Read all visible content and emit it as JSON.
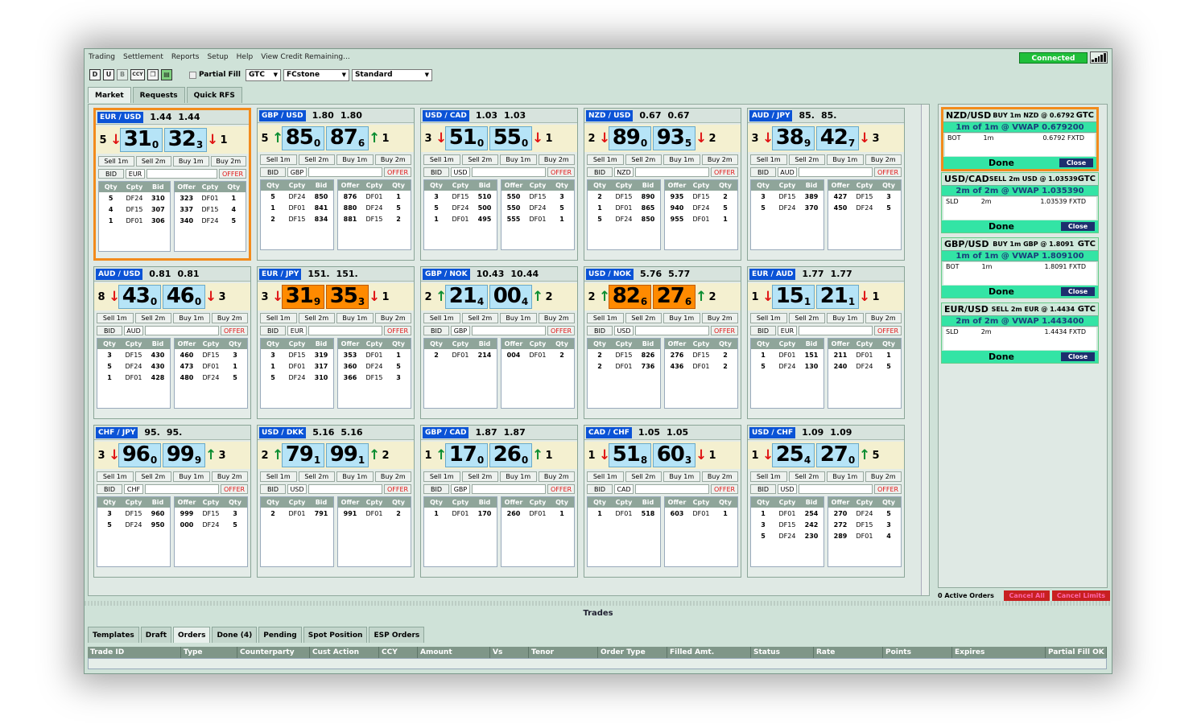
{
  "menu": [
    "Trading",
    "Settlement",
    "Reports",
    "Setup",
    "Help",
    "View Credit Remaining..."
  ],
  "status": "Connected",
  "toolbar": {
    "icons": [
      "D",
      "U",
      "B",
      "CCY",
      "copy-icon",
      "sheet-icon"
    ],
    "partial_fill": "Partial Fill",
    "tif": "GTC",
    "counterparty": "FCstone",
    "profile": "Standard"
  },
  "tabs": [
    "Market",
    "Requests",
    "Quick RFS"
  ],
  "tile_labels": {
    "sell1": "Sell 1m",
    "sell2": "Sell 2m",
    "buy1": "Buy 1m",
    "buy2": "Buy 2m",
    "bid": "BID",
    "offer": "OFFER",
    "cols": [
      "Qty",
      "Cpty",
      "Bid",
      "Offer",
      "Cpty",
      "Qty"
    ]
  },
  "tiles": [
    {
      "pair": "EUR / USD",
      "h1": "1.44",
      "h2": "1.44",
      "lq": "5",
      "la": "dn",
      "bid": "31",
      "bs": "0",
      "ask": "32",
      "as": "3",
      "ra": "dn",
      "rq": "1",
      "ccy": "EUR",
      "sel": true,
      "bids": [
        [
          "5",
          "DF24",
          "310"
        ],
        [
          "4",
          "DF15",
          "307"
        ],
        [
          "1",
          "DF01",
          "306"
        ]
      ],
      "offers": [
        [
          "323",
          "DF01",
          "1"
        ],
        [
          "337",
          "DF15",
          "4"
        ],
        [
          "340",
          "DF24",
          "5"
        ]
      ]
    },
    {
      "pair": "GBP / USD",
      "h1": "1.80",
      "h2": "1.80",
      "lq": "5",
      "la": "up",
      "bid": "85",
      "bs": "0",
      "ask": "87",
      "as": "6",
      "ra": "up",
      "rq": "1",
      "ccy": "GBP",
      "bids": [
        [
          "5",
          "DF24",
          "850"
        ],
        [
          "1",
          "DF01",
          "841"
        ],
        [
          "2",
          "DF15",
          "834"
        ]
      ],
      "offers": [
        [
          "876",
          "DF01",
          "1"
        ],
        [
          "880",
          "DF24",
          "5"
        ],
        [
          "881",
          "DF15",
          "2"
        ]
      ]
    },
    {
      "pair": "USD / CAD",
      "h1": "1.03",
      "h2": "1.03",
      "lq": "3",
      "la": "dn",
      "bid": "51",
      "bs": "0",
      "ask": "55",
      "as": "0",
      "ra": "dn",
      "rq": "1",
      "ccy": "USD",
      "bids": [
        [
          "3",
          "DF15",
          "510"
        ],
        [
          "5",
          "DF24",
          "500"
        ],
        [
          "1",
          "DF01",
          "495"
        ]
      ],
      "offers": [
        [
          "550",
          "DF15",
          "3"
        ],
        [
          "550",
          "DF24",
          "5"
        ],
        [
          "555",
          "DF01",
          "1"
        ]
      ]
    },
    {
      "pair": "NZD / USD",
      "h1": "0.67",
      "h2": "0.67",
      "lq": "2",
      "la": "dn",
      "bid": "89",
      "bs": "0",
      "ask": "93",
      "as": "5",
      "ra": "dn",
      "rq": "2",
      "ccy": "NZD",
      "bids": [
        [
          "2",
          "DF15",
          "890"
        ],
        [
          "1",
          "DF01",
          "865"
        ],
        [
          "5",
          "DF24",
          "850"
        ]
      ],
      "offers": [
        [
          "935",
          "DF15",
          "2"
        ],
        [
          "940",
          "DF24",
          "5"
        ],
        [
          "955",
          "DF01",
          "1"
        ]
      ]
    },
    {
      "pair": "AUD / JPY",
      "h1": "85.",
      "h2": "85.",
      "lq": "3",
      "la": "dn",
      "bid": "38",
      "bs": "9",
      "ask": "42",
      "as": "7",
      "ra": "dn",
      "rq": "3",
      "ccy": "AUD",
      "bids": [
        [
          "3",
          "DF15",
          "389"
        ],
        [
          "5",
          "DF24",
          "370"
        ]
      ],
      "offers": [
        [
          "427",
          "DF15",
          "3"
        ],
        [
          "450",
          "DF24",
          "5"
        ]
      ]
    },
    {
      "pair": "AUD / USD",
      "h1": "0.81",
      "h2": "0.81",
      "lq": "8",
      "la": "dn",
      "bid": "43",
      "bs": "0",
      "ask": "46",
      "as": "0",
      "ra": "dn",
      "rq": "3",
      "ccy": "AUD",
      "bids": [
        [
          "3",
          "DF15",
          "430"
        ],
        [
          "5",
          "DF24",
          "430"
        ],
        [
          "1",
          "DF01",
          "428"
        ]
      ],
      "offers": [
        [
          "460",
          "DF15",
          "3"
        ],
        [
          "473",
          "DF01",
          "1"
        ],
        [
          "480",
          "DF24",
          "5"
        ]
      ]
    },
    {
      "pair": "EUR / JPY",
      "h1": "151.",
      "h2": "151.",
      "lq": "3",
      "la": "dn",
      "bid": "31",
      "bs": "9",
      "ask": "35",
      "as": "3",
      "ra": "dn",
      "rq": "1",
      "ccy": "EUR",
      "hot": true,
      "bids": [
        [
          "3",
          "DF15",
          "319"
        ],
        [
          "1",
          "DF01",
          "317"
        ],
        [
          "5",
          "DF24",
          "310"
        ]
      ],
      "offers": [
        [
          "353",
          "DF01",
          "1"
        ],
        [
          "360",
          "DF24",
          "5"
        ],
        [
          "366",
          "DF15",
          "3"
        ]
      ]
    },
    {
      "pair": "GBP / NOK",
      "h1": "10.43",
      "h2": "10.44",
      "lq": "2",
      "la": "up",
      "bid": "21",
      "bs": "4",
      "ask": "00",
      "as": "4",
      "ra": "up",
      "rq": "2",
      "ccy": "GBP",
      "bids": [
        [
          "2",
          "DF01",
          "214"
        ]
      ],
      "offers": [
        [
          "004",
          "DF01",
          "2"
        ]
      ]
    },
    {
      "pair": "USD / NOK",
      "h1": "5.76",
      "h2": "5.77",
      "lq": "2",
      "la": "up",
      "bid": "82",
      "bs": "6",
      "ask": "27",
      "as": "6",
      "ra": "up",
      "rq": "2",
      "ccy": "USD",
      "hot": true,
      "bids": [
        [
          "2",
          "DF15",
          "826"
        ],
        [
          "2",
          "DF01",
          "736"
        ]
      ],
      "offers": [
        [
          "276",
          "DF15",
          "2"
        ],
        [
          "436",
          "DF01",
          "2"
        ]
      ]
    },
    {
      "pair": "EUR / AUD",
      "h1": "1.77",
      "h2": "1.77",
      "lq": "1",
      "la": "dn",
      "bid": "15",
      "bs": "1",
      "ask": "21",
      "as": "1",
      "ra": "dn",
      "rq": "1",
      "ccy": "EUR",
      "bids": [
        [
          "1",
          "DF01",
          "151"
        ],
        [
          "5",
          "DF24",
          "130"
        ]
      ],
      "offers": [
        [
          "211",
          "DF01",
          "1"
        ],
        [
          "240",
          "DF24",
          "5"
        ]
      ]
    },
    {
      "pair": "CHF / JPY",
      "h1": "95.",
      "h2": "95.",
      "lq": "3",
      "la": "dn",
      "bid": "96",
      "bs": "0",
      "ask": "99",
      "as": "9",
      "ra": "up",
      "rq": "3",
      "ccy": "CHF",
      "bids": [
        [
          "3",
          "DF15",
          "960"
        ],
        [
          "5",
          "DF24",
          "950"
        ]
      ],
      "offers": [
        [
          "999",
          "DF15",
          "3"
        ],
        [
          "000",
          "DF24",
          "5"
        ]
      ]
    },
    {
      "pair": "USD / DKK",
      "h1": "5.16",
      "h2": "5.16",
      "lq": "2",
      "la": "up",
      "bid": "79",
      "bs": "1",
      "ask": "99",
      "as": "1",
      "ra": "up",
      "rq": "2",
      "ccy": "USD",
      "bids": [
        [
          "2",
          "DF01",
          "791"
        ]
      ],
      "offers": [
        [
          "991",
          "DF01",
          "2"
        ]
      ]
    },
    {
      "pair": "GBP / CAD",
      "h1": "1.87",
      "h2": "1.87",
      "lq": "1",
      "la": "up",
      "bid": "17",
      "bs": "0",
      "ask": "26",
      "as": "0",
      "ra": "up",
      "rq": "1",
      "ccy": "GBP",
      "bids": [
        [
          "1",
          "DF01",
          "170"
        ]
      ],
      "offers": [
        [
          "260",
          "DF01",
          "1"
        ]
      ]
    },
    {
      "pair": "CAD / CHF",
      "h1": "1.05",
      "h2": "1.05",
      "lq": "1",
      "la": "dn",
      "bid": "51",
      "bs": "8",
      "ask": "60",
      "as": "3",
      "ra": "dn",
      "rq": "1",
      "ccy": "CAD",
      "bids": [
        [
          "1",
          "DF01",
          "518"
        ]
      ],
      "offers": [
        [
          "603",
          "DF01",
          "1"
        ]
      ]
    },
    {
      "pair": "USD / CHF",
      "h1": "1.09",
      "h2": "1.09",
      "lq": "1",
      "la": "dn",
      "bid": "25",
      "bs": "4",
      "ask": "27",
      "as": "0",
      "ra": "up",
      "rq": "5",
      "ccy": "USD",
      "bids": [
        [
          "1",
          "DF01",
          "254"
        ],
        [
          "3",
          "DF15",
          "242"
        ],
        [
          "5",
          "DF24",
          "230"
        ]
      ],
      "offers": [
        [
          "270",
          "DF24",
          "5"
        ],
        [
          "272",
          "DF15",
          "3"
        ],
        [
          "289",
          "DF01",
          "4"
        ]
      ]
    }
  ],
  "orders": [
    {
      "pair": "NZD/USD",
      "desc": "BUY 1m NZD @ 0.6792",
      "tif": "GTC",
      "vwap": "1m of 1m @ VWAP 0.679200",
      "side": "BOT",
      "size": "1m",
      "fill": "0.6792 FXTD",
      "done": "Done",
      "close": "Close",
      "sel": true
    },
    {
      "pair": "USD/CAD",
      "desc": "SELL 2m USD @ 1.03539",
      "tif": "GTC",
      "vwap": "2m of 2m @ VWAP 1.035390",
      "side": "SLD",
      "size": "2m",
      "fill": "1.03539 FXTD",
      "done": "Done",
      "close": "Close"
    },
    {
      "pair": "GBP/USD",
      "desc": "BUY 1m GBP @ 1.8091",
      "tif": "GTC",
      "vwap": "1m of 1m @ VWAP 1.809100",
      "side": "BOT",
      "size": "1m",
      "fill": "1.8091 FXTD",
      "done": "Done",
      "close": "Close"
    },
    {
      "pair": "EUR/USD",
      "desc": "SELL 2m EUR @ 1.4434",
      "tif": "GTC",
      "vwap": "2m of 2m @ VWAP 1.443400",
      "side": "SLD",
      "size": "2m",
      "fill": "1.4434 FXTD",
      "done": "Done",
      "close": "Close"
    }
  ],
  "active_orders": "0 Active Orders",
  "cancel_all": "Cancel All",
  "cancel_limits": "Cancel Limits",
  "trades_title": "Trades",
  "bottom_tabs": [
    "Templates",
    "Draft",
    "Orders",
    "Done (4)",
    "Pending",
    "Spot Position",
    "ESP Orders"
  ],
  "columns": [
    "Trade ID",
    "Type",
    "Counterparty",
    "Cust Action",
    "CCY",
    "Amount",
    "Vs",
    "Tenor",
    "Order Type",
    "Filled Amt.",
    "Status",
    "Rate",
    "Points",
    "Expires",
    "Partial Fill OK"
  ]
}
